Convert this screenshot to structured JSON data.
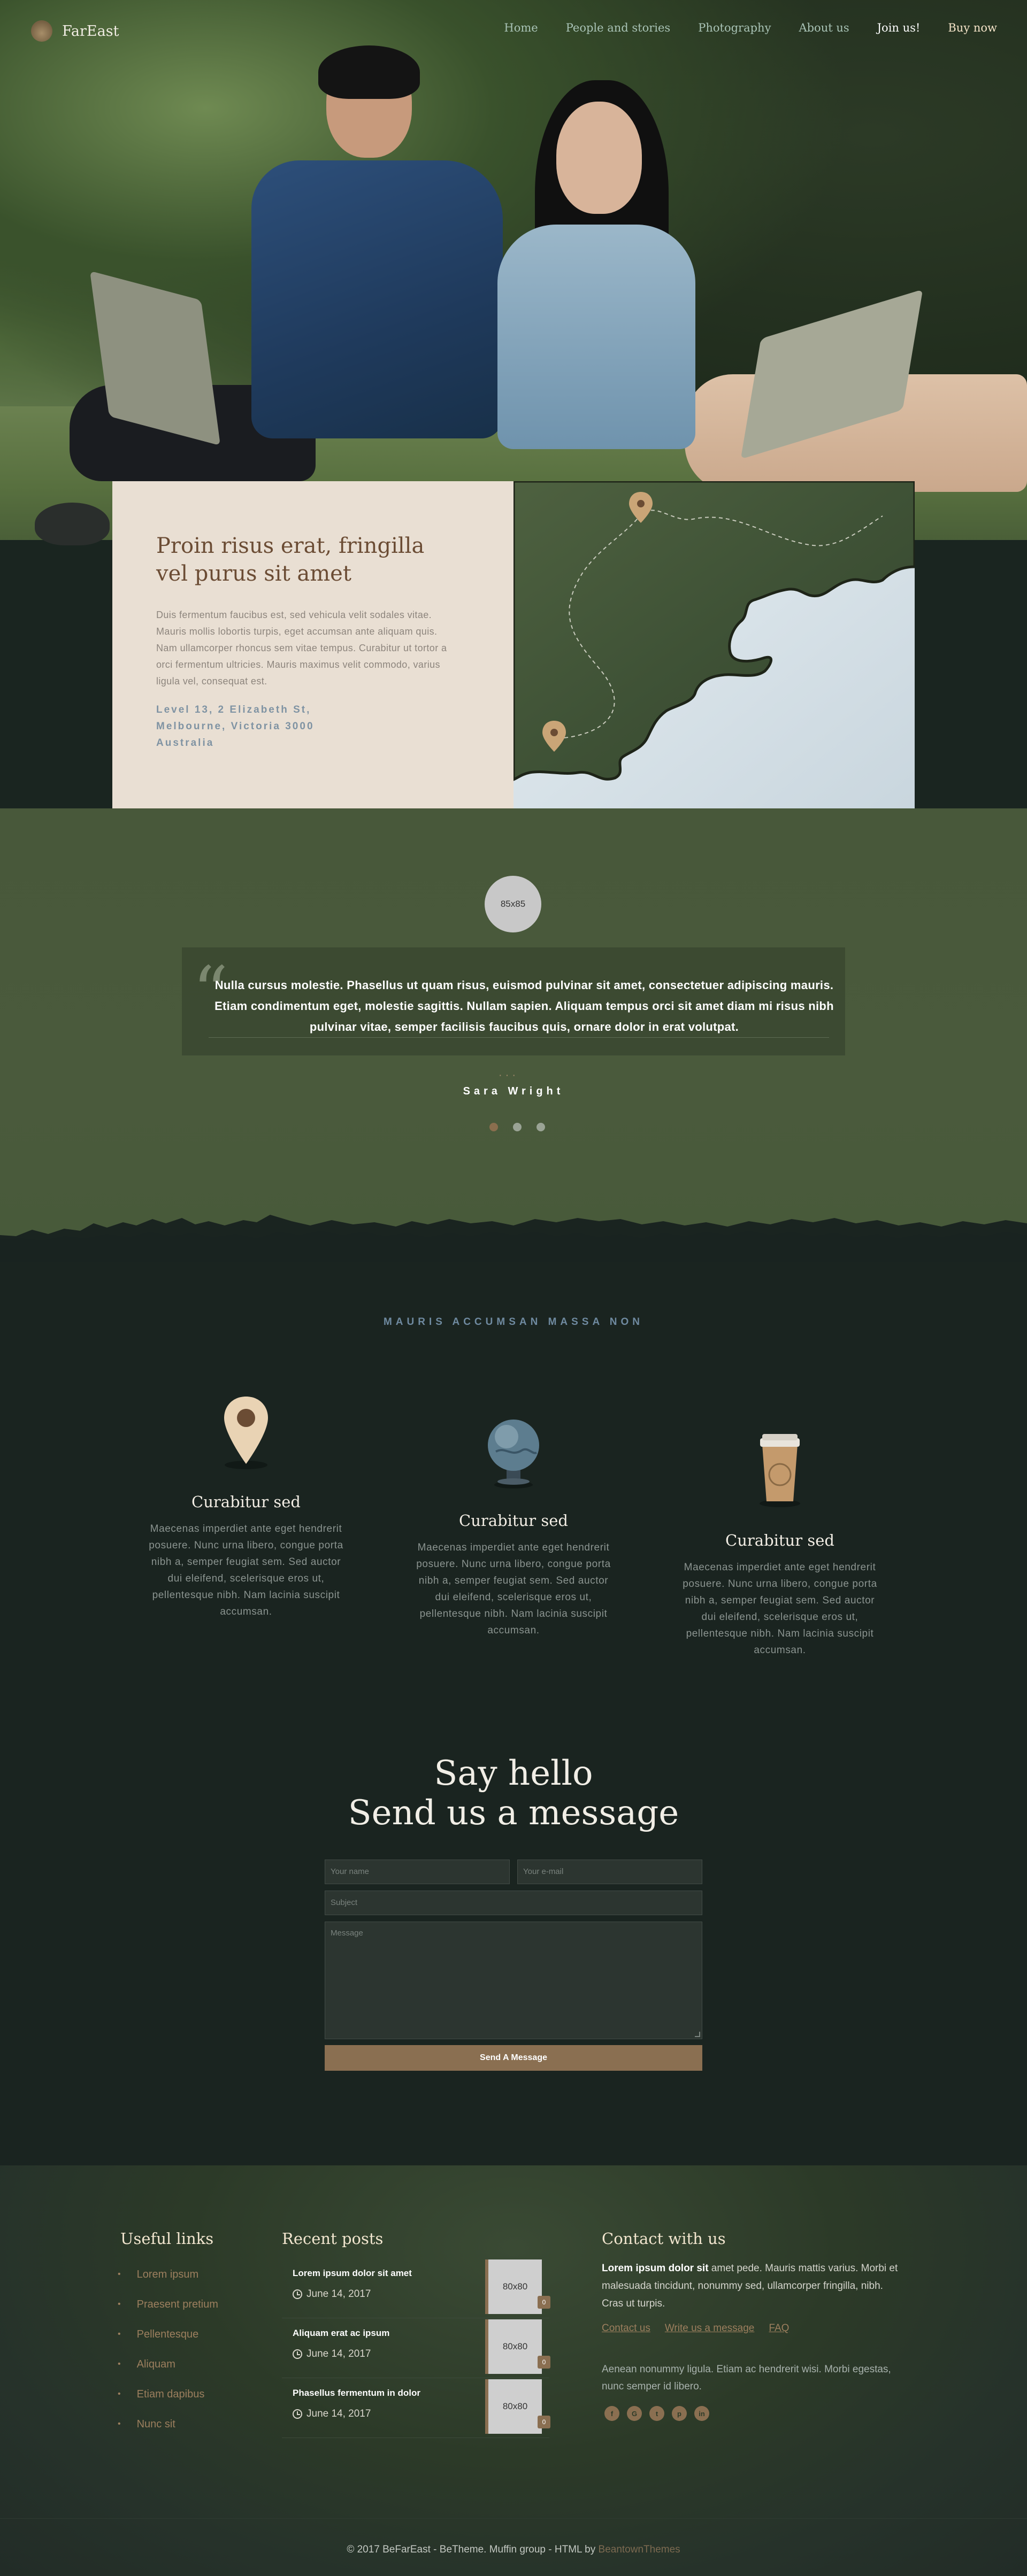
{
  "nav": {
    "brand": "FarEast",
    "items": [
      {
        "label": "Home",
        "key": "home"
      },
      {
        "label": "People and stories",
        "key": "people"
      },
      {
        "label": "Photography",
        "key": "photography"
      },
      {
        "label": "About us",
        "key": "about"
      },
      {
        "label": "Join us!",
        "key": "join"
      },
      {
        "label": "Buy now",
        "key": "buy"
      }
    ]
  },
  "info": {
    "title": "Proin risus erat, fringilla vel purus sit amet",
    "body": "Duis fermentum faucibus est, sed vehicula velit sodales vitae. Mauris mollis lobortis turpis, eget accumsan ante aliquam quis. Nam ullamcorper rhoncus sem vitae tempus. Curabitur ut tortor a orci fermentum ultricies. Mauris maximus velit commodo, varius ligula vel, consequat est.",
    "address": [
      "Level 13, 2 Elizabeth St,",
      "Melbourne, Victoria 3000",
      "Australia"
    ]
  },
  "testimonial": {
    "avatar_placeholder": "85x85",
    "quote": "Nulla cursus molestie. Phasellus ut quam risus, euismod pulvinar sit amet, consectetuer adipiscing mauris. Etiam condimentum eget, molestie sagittis. Nullam sapien. Aliquam tempus orci sit amet diam mi risus nibh pulvinar vitae, semper facilisis faucibus quis, ornare dolor in erat volutpat.",
    "author": "Sara Wright",
    "pages": 3,
    "active_page": 1
  },
  "features": {
    "eyebrow": "MAURIS ACCUMSAN MASSA NON",
    "items": [
      {
        "icon": "map-pin-icon",
        "title": "Curabitur sed",
        "text": "Maecenas imperdiet ante eget hendrerit posuere. Nunc urna libero, congue porta nibh a, semper feugiat sem. Sed auctor dui eleifend, scelerisque eros ut, pellentesque nibh. Nam lacinia suscipit accumsan."
      },
      {
        "icon": "globe-icon",
        "title": "Curabitur sed",
        "text": "Maecenas imperdiet ante eget hendrerit posuere. Nunc urna libero, congue porta nibh a, semper feugiat sem. Sed auctor dui eleifend, scelerisque eros ut, pellentesque nibh. Nam lacinia suscipit accumsan."
      },
      {
        "icon": "coffee-cup-icon",
        "title": "Curabitur sed",
        "text": "Maecenas imperdiet ante eget hendrerit posuere. Nunc urna libero, congue porta nibh a, semper feugiat sem. Sed auctor dui eleifend, scelerisque eros ut, pellentesque nibh. Nam lacinia suscipit accumsan."
      }
    ]
  },
  "contact_form": {
    "heading_line1": "Say hello",
    "heading_line2": "Send us a message",
    "name_placeholder": "Your name",
    "email_placeholder": "Your e-mail",
    "subject_placeholder": "Subject",
    "message_placeholder": "Message",
    "submit": "Send A Message"
  },
  "footer": {
    "useful_links_title": "Useful links",
    "useful_links": [
      "Lorem ipsum",
      "Praesent pretium",
      "Pellentesque",
      "Aliquam",
      "Etiam dapibus",
      "Nunc sit"
    ],
    "recent_posts_title": "Recent posts",
    "posts": [
      {
        "title": "Lorem ipsum dolor sit amet",
        "date": "June 14, 2017",
        "thumb": "80x80",
        "comments": "0"
      },
      {
        "title": "Aliquam erat ac ipsum",
        "date": "June 14, 2017",
        "thumb": "80x80",
        "comments": "0"
      },
      {
        "title": "Phasellus fermentum in dolor",
        "date": "June 14, 2017",
        "thumb": "80x80",
        "comments": "0"
      }
    ],
    "contact_title": "Contact with us",
    "contact_bold": "Lorem ipsum dolor sit",
    "contact_body": " amet pede. Mauris mattis varius. Morbi et malesuada tincidunt, nonummy sed, ullamcorper fringilla, nibh. Cras ut turpis.",
    "contact_links": [
      "Contact us",
      "Write us a message",
      "FAQ"
    ],
    "contact_body2": "Aenean nonummy ligula. Etiam ac hendrerit wisi. Morbi egestas, nunc semper id libero.",
    "socials": [
      {
        "icon": "facebook-icon",
        "glyph": "f"
      },
      {
        "icon": "google-plus-icon",
        "glyph": "G"
      },
      {
        "icon": "twitter-icon",
        "glyph": "t"
      },
      {
        "icon": "pinterest-icon",
        "glyph": "p"
      },
      {
        "icon": "linkedin-icon",
        "glyph": "in"
      }
    ],
    "copyright_prefix": "© 2017 BeFarEast - BeTheme. Muffin group - HTML by ",
    "copyright_brand": "BeantownThemes"
  },
  "colors": {
    "accent": "#8a6f51",
    "card_bg": "#e9dfd3",
    "dark_bg": "#1a2420",
    "green_band": "#4a5a3c"
  }
}
